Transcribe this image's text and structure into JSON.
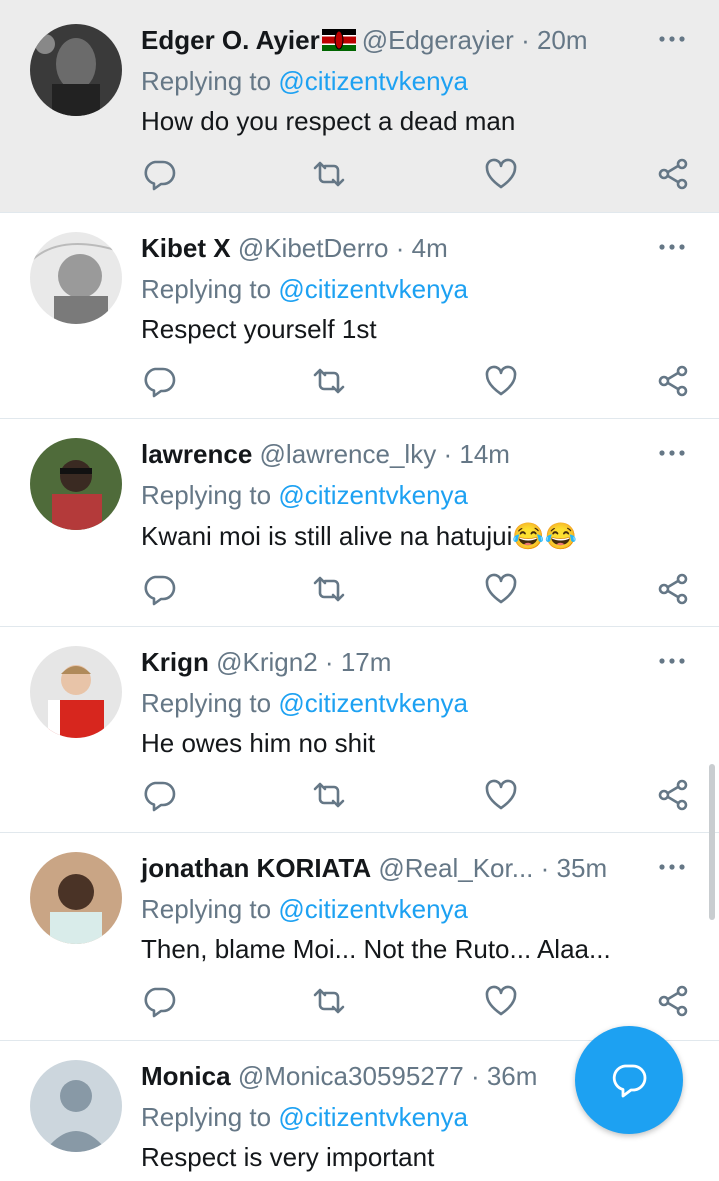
{
  "colors": {
    "accent": "#1da1f2",
    "muted": "#657786",
    "text": "#14171a",
    "highlight": "#ececec"
  },
  "tweets": [
    {
      "name": "Edger O. Ayier",
      "handle": "@Edgerayier",
      "sep": "·",
      "time": "20m",
      "reply_prefix": "Replying to",
      "mention": "@citizentvkenya",
      "text": "How do you respect a dead man",
      "has_flag": true
    },
    {
      "name": "Kibet X",
      "handle": "@KibetDerro",
      "sep": "·",
      "time": "4m",
      "reply_prefix": "Replying to",
      "mention": "@citizentvkenya",
      "text": "Respect yourself 1st"
    },
    {
      "name": "lawrence",
      "handle": "@lawrence_lky",
      "sep": "·",
      "time": "14m",
      "reply_prefix": "Replying to",
      "mention": "@citizentvkenya",
      "text": "Kwani moi is still alive na hatujui😂😂"
    },
    {
      "name": "Krign",
      "handle": "@Krign2",
      "sep": "·",
      "time": "17m",
      "reply_prefix": "Replying to",
      "mention": "@citizentvkenya",
      "text": "He owes him no shit"
    },
    {
      "name": "jonathan KORIATA",
      "handle": "@Real_Kor...",
      "sep": "·",
      "time": "35m",
      "reply_prefix": "Replying to",
      "mention": "@citizentvkenya",
      "text": "Then, blame Moi... Not the Ruto... Alaa..."
    },
    {
      "name": "Monica",
      "handle": "@Monica30595277",
      "sep": "·",
      "time": "36m",
      "reply_prefix": "Replying to",
      "mention": "@citizentvkenya",
      "text": "Respect is very important"
    }
  ],
  "icons": {
    "reply": "comment-icon",
    "retweet": "retweet-icon",
    "like": "heart-icon",
    "share": "share-icon",
    "more": "more-icon",
    "compose": "compose-reply-icon"
  }
}
